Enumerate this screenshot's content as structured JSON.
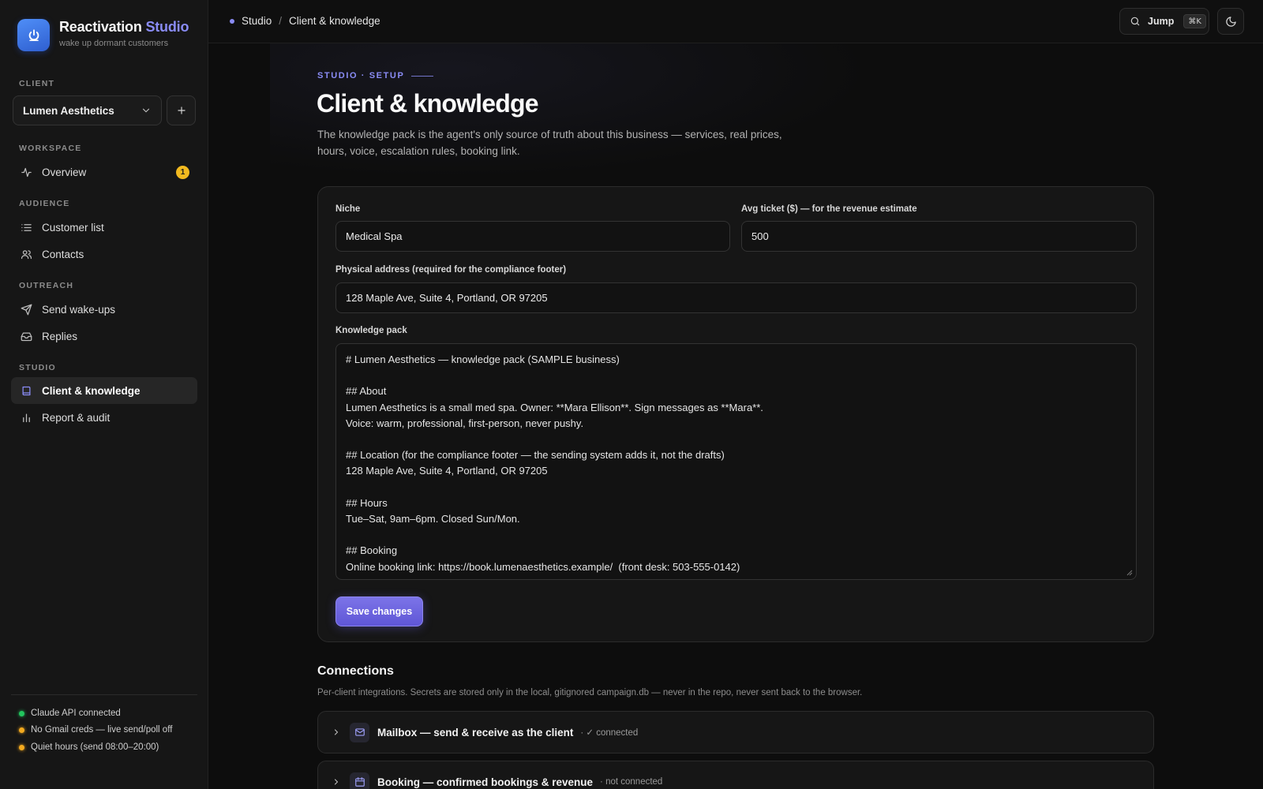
{
  "brand": {
    "title_main": "Reactivation",
    "title_accent": "Studio",
    "subtitle": "wake up dormant customers"
  },
  "sidebar": {
    "client_label": "CLIENT",
    "client_selected": "Lumen Aesthetics",
    "sections": {
      "workspace": "WORKSPACE",
      "audience": "AUDIENCE",
      "outreach": "OUTREACH",
      "studio": "STUDIO"
    },
    "items": {
      "overview": {
        "label": "Overview",
        "badge": "1"
      },
      "customer_list": {
        "label": "Customer list"
      },
      "contacts": {
        "label": "Contacts"
      },
      "send_wakeups": {
        "label": "Send wake-ups"
      },
      "replies": {
        "label": "Replies"
      },
      "client_knowledge": {
        "label": "Client & knowledge"
      },
      "report_audit": {
        "label": "Report & audit"
      }
    },
    "status": [
      {
        "text": "Claude API connected",
        "color": "#22c55e"
      },
      {
        "text": "No Gmail creds — live send/poll off",
        "color": "#f2a91f"
      },
      {
        "text": "Quiet hours (send 08:00–20:00)",
        "color": "#f2a91f"
      }
    ]
  },
  "topbar": {
    "breadcrumb_root": "Studio",
    "breadcrumb_sep": "/",
    "breadcrumb_current": "Client & knowledge",
    "jump_label": "Jump",
    "jump_shortcut": "⌘K"
  },
  "page": {
    "eyebrow": "STUDIO · SETUP",
    "title": "Client & knowledge",
    "description": "The knowledge pack is the agent's only source of truth about this business — services, real prices, hours, voice, escalation rules, booking link."
  },
  "form": {
    "niche_label": "Niche",
    "niche_value": "Medical Spa",
    "ticket_label": "Avg ticket ($) — for the revenue estimate",
    "ticket_value": "500",
    "address_label": "Physical address (required for the compliance footer)",
    "address_value": "128 Maple Ave, Suite 4, Portland, OR 97205",
    "knowledge_label": "Knowledge pack",
    "knowledge_value": "# Lumen Aesthetics — knowledge pack (SAMPLE business)\n\n## About\nLumen Aesthetics is a small med spa. Owner: **Mara Ellison**. Sign messages as **Mara**.\nVoice: warm, professional, first-person, never pushy.\n\n## Location (for the compliance footer — the sending system adds it, not the drafts)\n128 Maple Ave, Suite 4, Portland, OR 97205\n\n## Hours\nTue–Sat, 9am–6pm. Closed Sun/Mon.\n\n## Booking\nOnline booking link: https://book.lumenaesthetics.example/  (front desk: 503-555-0142)",
    "save_label": "Save changes"
  },
  "connections": {
    "title": "Connections",
    "description": "Per-client integrations. Secrets are stored only in the local, gitignored campaign.db — never in the repo, never sent back to the browser.",
    "items": [
      {
        "name": "Mailbox — send & receive as the client",
        "status": "· ✓ connected"
      },
      {
        "name": "Booking — confirmed bookings & revenue",
        "status": "· not connected"
      }
    ]
  },
  "colors": {
    "accent": "#8a8cf5",
    "primary_button": "#6b63de",
    "badge": "#f2b91f",
    "brand_logo": "#3f76e8"
  }
}
